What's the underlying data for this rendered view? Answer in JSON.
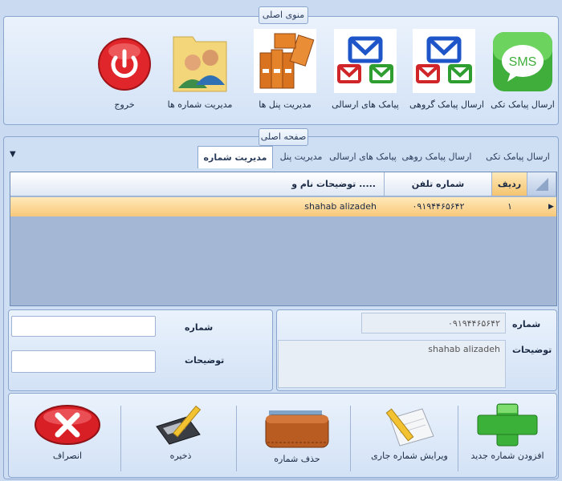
{
  "ribbon": {
    "caption": "منوی اصلی",
    "buttons": [
      {
        "label": "ارسال پیامک تکی",
        "icon": "sms-icon"
      },
      {
        "label": "ارسال پیامک گروهی",
        "icon": "group-mail-icon"
      },
      {
        "label": "پیامک های ارسالی",
        "icon": "sent-mail-icon"
      },
      {
        "label": "مدیریت پنل ها",
        "icon": "binders-icon"
      },
      {
        "label": "مدیریت شماره ها",
        "icon": "contacts-icon"
      },
      {
        "label": "خروج",
        "icon": "power-icon"
      }
    ],
    "sms_text": "SMS"
  },
  "main": {
    "caption": "صفحه اصلی",
    "tabs": [
      {
        "label": "ارسال پیامک تکی"
      },
      {
        "label": "ارسال پیامک روهی"
      },
      {
        "label": "پیامک های ارسالی"
      },
      {
        "label": "مدیریت پنل"
      },
      {
        "label": "مدیریت شماره ها",
        "active": true
      }
    ]
  },
  "grid": {
    "columns": [
      "ردیف",
      "شماره تلفن",
      "توضیحات نام و ....."
    ],
    "rows": [
      {
        "index": "۱",
        "phone": "۰۹۱۹۴۴۶۵۶۴۲",
        "desc": "shahab alizadeh"
      }
    ]
  },
  "details": {
    "number_label": "شماره",
    "number_value": "۰۹۱۹۴۴۶۵۶۴۲",
    "desc_label": "توضیحات",
    "desc_value": "shahab alizadeh"
  },
  "form": {
    "number_label": "شماره",
    "desc_label": "توضیحات",
    "number_value": "",
    "desc_value": ""
  },
  "actions": {
    "add": "افزودن شماره جدید",
    "edit": "ویرایش شماره جاری",
    "delete": "حذف شماره",
    "save": "ذخیره",
    "cancel": "انصراف"
  },
  "colors": {
    "accent_green": "#3fae3a",
    "row_highlight": "#f8c87a",
    "window_bg": "#c9daf1"
  }
}
